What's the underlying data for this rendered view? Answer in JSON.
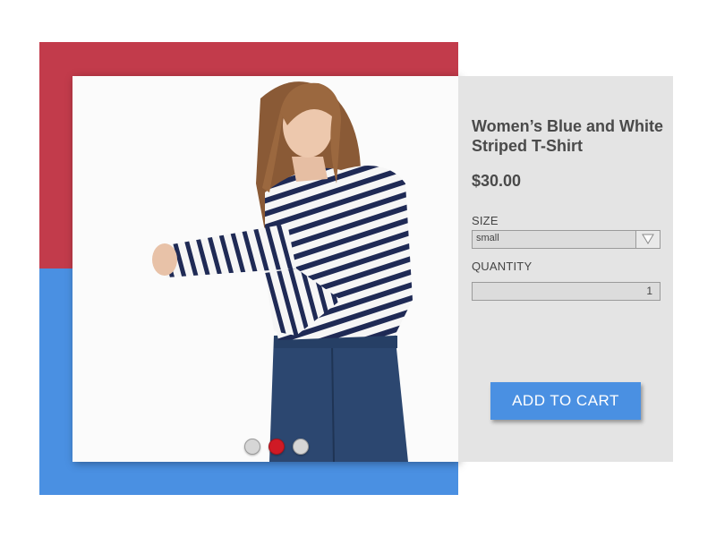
{
  "colors": {
    "top_band": "#c23b4b",
    "bottom_band": "#4a90e2",
    "panel": "#e4e4e4",
    "button": "#4a90e2",
    "active_dot": "#cf1a25"
  },
  "product": {
    "image_icon": "product-photo",
    "title": "Women’s Blue and White Striped T-Shirt",
    "price": "$30.00"
  },
  "carousel": {
    "dots": [
      {
        "active": false
      },
      {
        "active": true
      },
      {
        "active": false
      }
    ]
  },
  "size": {
    "label": "SIZE",
    "selected": "small",
    "icon": "chevron-down-icon"
  },
  "quantity": {
    "label": "QUANTITY",
    "value": "1"
  },
  "cart": {
    "button_label": "ADD TO CART"
  }
}
